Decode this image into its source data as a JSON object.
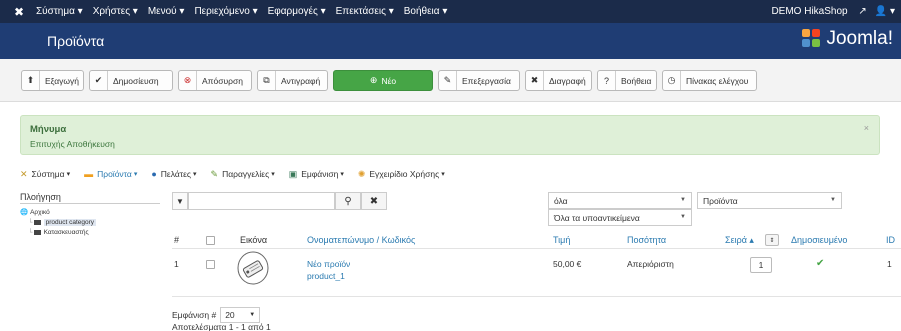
{
  "topnav": {
    "menu": [
      "Σύστημα ▾",
      "Χρήστες ▾",
      "Μενού ▾",
      "Περιεχόμενο ▾",
      "Εφαρμογές ▾",
      "Επεκτάσεις ▾",
      "Βοήθεια ▾"
    ],
    "site_name": "DEMO HikaShop",
    "external_icon": "↗",
    "user_icon": "👤 ▾"
  },
  "header": {
    "title": "Προϊόντα",
    "brand": "Joomla!"
  },
  "toolbar": {
    "export": "Εξαγωγή",
    "publish": "Δημοσίευση",
    "unpublish": "Απόσυρση",
    "copy": "Αντιγραφή",
    "new": "Νέο",
    "edit": "Επεξεργασία",
    "delete": "Διαγραφή",
    "help": "Βοήθεια",
    "dashboard": "Πίνακας ελέγχου"
  },
  "message": {
    "title": "Μήνυμα",
    "body": "Επιτυχής Αποθήκευση",
    "close": "×"
  },
  "hikamenu": {
    "items": [
      {
        "label": "Σύστημα",
        "icon": "wrench-icon"
      },
      {
        "label": "Προϊόντα",
        "icon": "product-icon"
      },
      {
        "label": "Πελάτες",
        "icon": "customers-icon"
      },
      {
        "label": "Παραγγελίες",
        "icon": "orders-icon"
      },
      {
        "label": "Εμφάνιση",
        "icon": "display-icon"
      },
      {
        "label": "Εγχειρίδιο Χρήσης",
        "icon": "help-icon"
      }
    ]
  },
  "sidebar": {
    "title": "Πλοήγηση",
    "root": "Αρχικό",
    "child1": "product category",
    "child2": "Κατασκευαστής"
  },
  "filters": {
    "search_value": "",
    "select1": "όλα",
    "select2": "Όλα τα υποαντικείμενα",
    "select3": "Προϊόντα",
    "select4": ""
  },
  "table": {
    "headers": {
      "num": "#",
      "image": "Εικόνα",
      "name": "Ονοματεπώνυμο / Κωδικός",
      "price": "Τιμή",
      "quantity": "Ποσότητα",
      "order": "Σειρά ▴",
      "published": "Δημοσιευμένο",
      "id": "ID"
    },
    "rows": [
      {
        "num": "1",
        "name": "Νέο προϊόν",
        "code": "product_1",
        "price": "50,00 €",
        "quantity": "Απεριόριστη",
        "order": "1",
        "published": "✔",
        "id": "1"
      }
    ]
  },
  "pagination": {
    "display_label": "Εμφάνιση #",
    "display_value": "20",
    "results": "Αποτελέσματα 1 - 1 από 1"
  },
  "colors": {
    "topbar": "#1b2b4a",
    "header": "#1f3d74",
    "new_button": "#46a546",
    "message_bg": "#dff0d8",
    "link": "#2a7ab0"
  }
}
